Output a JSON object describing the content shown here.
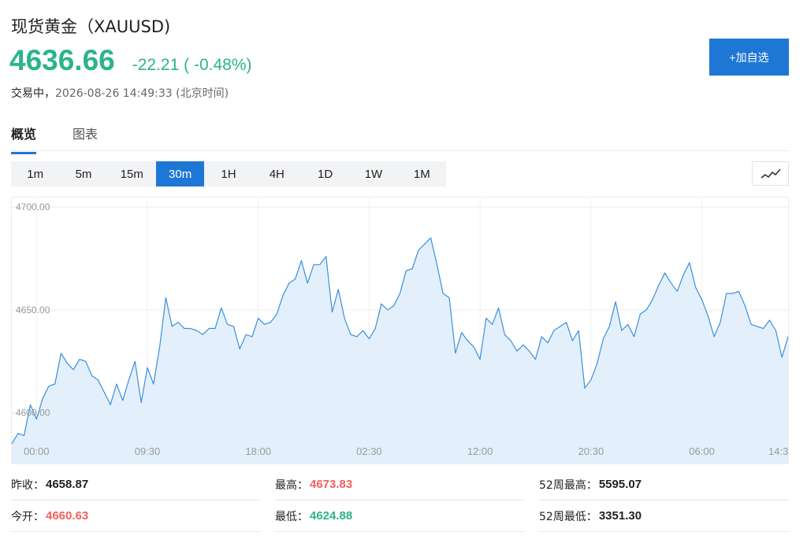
{
  "header": {
    "title": "现货黄金（XAUUSD)",
    "price": "4636.66",
    "change": "-22.21 ( -0.48%)",
    "status": "交易中，",
    "timestamp": "2026-08-26 14:49:33 (北京时间)",
    "add_button": "+加自选"
  },
  "tabs": [
    {
      "label": "概览",
      "active": true
    },
    {
      "label": "图表",
      "active": false
    }
  ],
  "timeframes": [
    {
      "label": "1m"
    },
    {
      "label": "5m"
    },
    {
      "label": "15m"
    },
    {
      "label": "30m",
      "active": true
    },
    {
      "label": "1H"
    },
    {
      "label": "4H"
    },
    {
      "label": "1D"
    },
    {
      "label": "1W"
    },
    {
      "label": "1M"
    }
  ],
  "chart_type_icon": "line-chart-icon",
  "colors": {
    "up": "#f0625b",
    "down": "#2bb48b",
    "accent": "#1f77d5",
    "line": "#3a8fdc",
    "area": "#e3f0fc"
  },
  "chart_data": {
    "type": "area",
    "ylim": [
      4575,
      4705
    ],
    "y_ticks": [
      "4700.00",
      "4650.00",
      "4600.00"
    ],
    "y_tick_values": [
      4700,
      4650,
      4600
    ],
    "x_ticks": [
      "00:00",
      "09:30",
      "18:00",
      "02:30",
      "12:00",
      "20:30",
      "06:00",
      "14:3"
    ],
    "x_tick_index": [
      4,
      22,
      40,
      58,
      76,
      94,
      112,
      130
    ],
    "values": [
      4585,
      4590,
      4589,
      4604,
      4597,
      4607,
      4613,
      4614,
      4629,
      4624,
      4621,
      4626,
      4625,
      4618,
      4616,
      4610,
      4604,
      4614,
      4606,
      4616,
      4625,
      4605,
      4622,
      4614,
      4632,
      4656,
      4642,
      4644,
      4641,
      4641,
      4640,
      4638,
      4641,
      4641,
      4651,
      4643,
      4642,
      4631,
      4638,
      4637,
      4646,
      4643,
      4644,
      4648,
      4657,
      4663,
      4665,
      4674,
      4663,
      4672,
      4672,
      4676,
      4649,
      4660,
      4646,
      4638,
      4637,
      4640,
      4636,
      4641,
      4653,
      4650,
      4652,
      4658,
      4669,
      4670,
      4679,
      4682,
      4685,
      4672,
      4658,
      4656,
      4629,
      4639,
      4635,
      4632,
      4626,
      4646,
      4643,
      4651,
      4638,
      4635,
      4630,
      4633,
      4630,
      4626,
      4637,
      4634,
      4640,
      4642,
      4644,
      4635,
      4640,
      4612,
      4616,
      4624,
      4636,
      4642,
      4654,
      4640,
      4643,
      4637,
      4648,
      4650,
      4655,
      4662,
      4668,
      4663,
      4659,
      4667,
      4673,
      4661,
      4655,
      4647,
      4637,
      4644,
      4658,
      4658,
      4659,
      4652,
      4643,
      4642,
      4641,
      4645,
      4640,
      4627,
      4637
    ]
  },
  "stats": [
    {
      "label": "昨收：",
      "value": "4658.87",
      "tone": "black"
    },
    {
      "label": "最高：",
      "value": "4673.83",
      "tone": "red"
    },
    {
      "label": "52周最高：",
      "value": "5595.07",
      "tone": "black"
    },
    {
      "label": "今开：",
      "value": "4660.63",
      "tone": "red"
    },
    {
      "label": "最低：",
      "value": "4624.88",
      "tone": "green"
    },
    {
      "label": "52周最低：",
      "value": "3351.30",
      "tone": "black"
    }
  ]
}
